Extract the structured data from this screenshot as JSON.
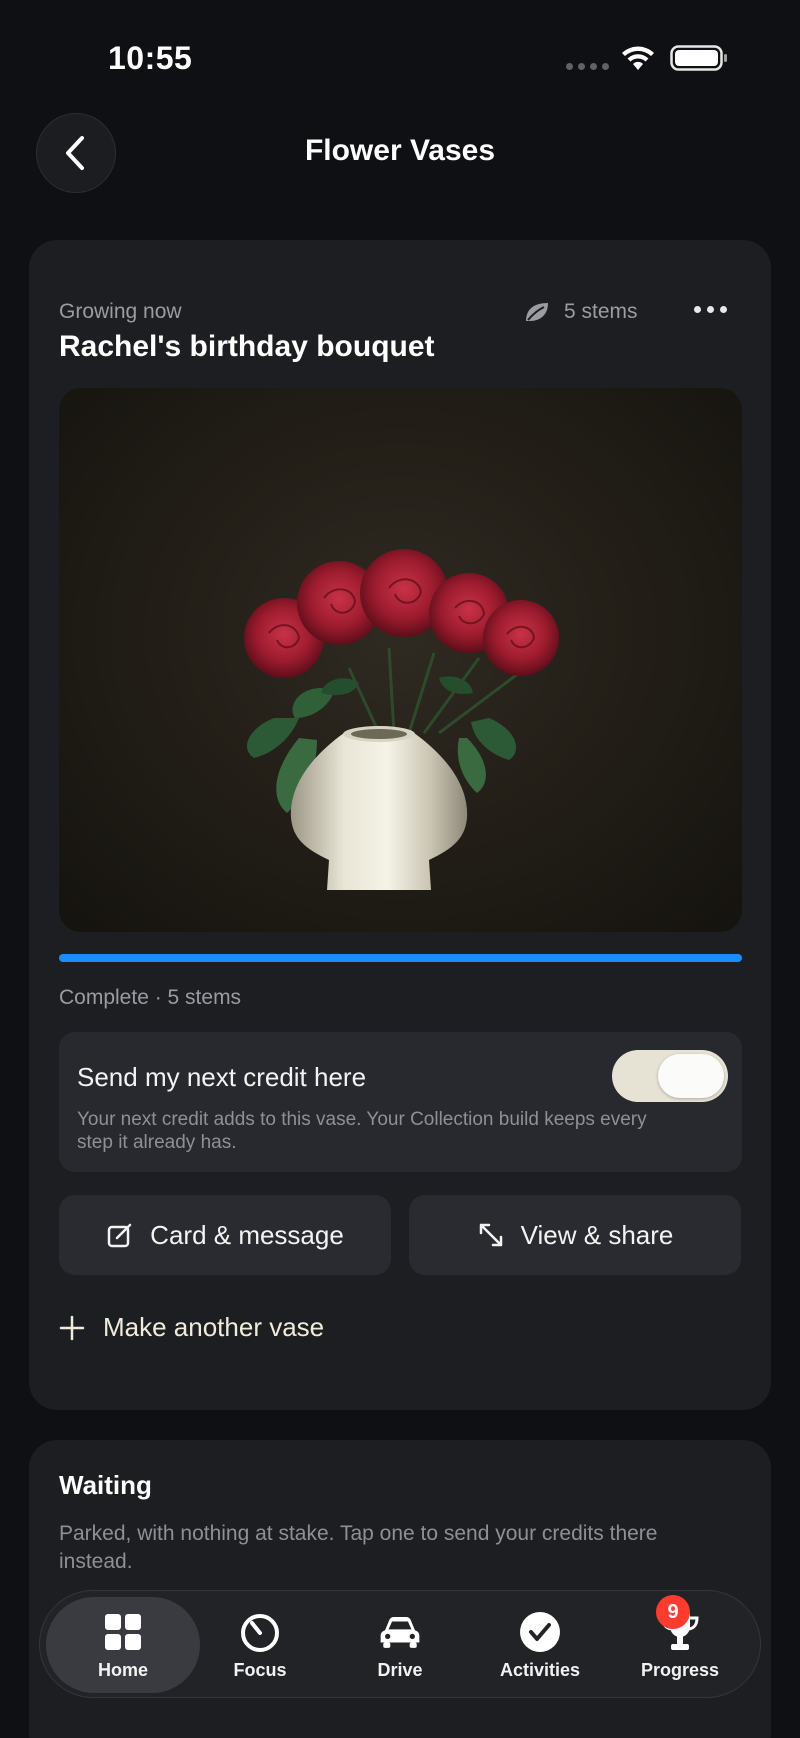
{
  "status_bar": {
    "time": "10:55"
  },
  "header": {
    "title": "Flower Vases"
  },
  "card": {
    "eyebrow": "Growing now",
    "stems": "5 stems",
    "title": "Rachel's birthday bouquet",
    "progress_percent": 100,
    "status_line": "Complete · 5 stems",
    "credit": {
      "title": "Send my next credit here",
      "description": "Your next credit adds to this vase. Your Collection build keeps every step it already has.",
      "enabled": true
    },
    "card_button": "Card & message",
    "view_button": "View & share",
    "make_another": "Make another vase"
  },
  "waiting": {
    "title": "Waiting",
    "description": "Parked, with nothing at stake. Tap one to send your credits there instead."
  },
  "tabs": [
    {
      "label": "Home",
      "icon": "home-grid-icon",
      "active": true
    },
    {
      "label": "Focus",
      "icon": "timer-icon"
    },
    {
      "label": "Drive",
      "icon": "car-icon"
    },
    {
      "label": "Activities",
      "icon": "checkmark-circle-icon"
    },
    {
      "label": "Progress",
      "icon": "trophy-icon",
      "badge": "9"
    }
  ],
  "colors": {
    "accent": "#1a8cff",
    "badge": "#ff3b30",
    "toggle_on": "#e6e2d4"
  }
}
